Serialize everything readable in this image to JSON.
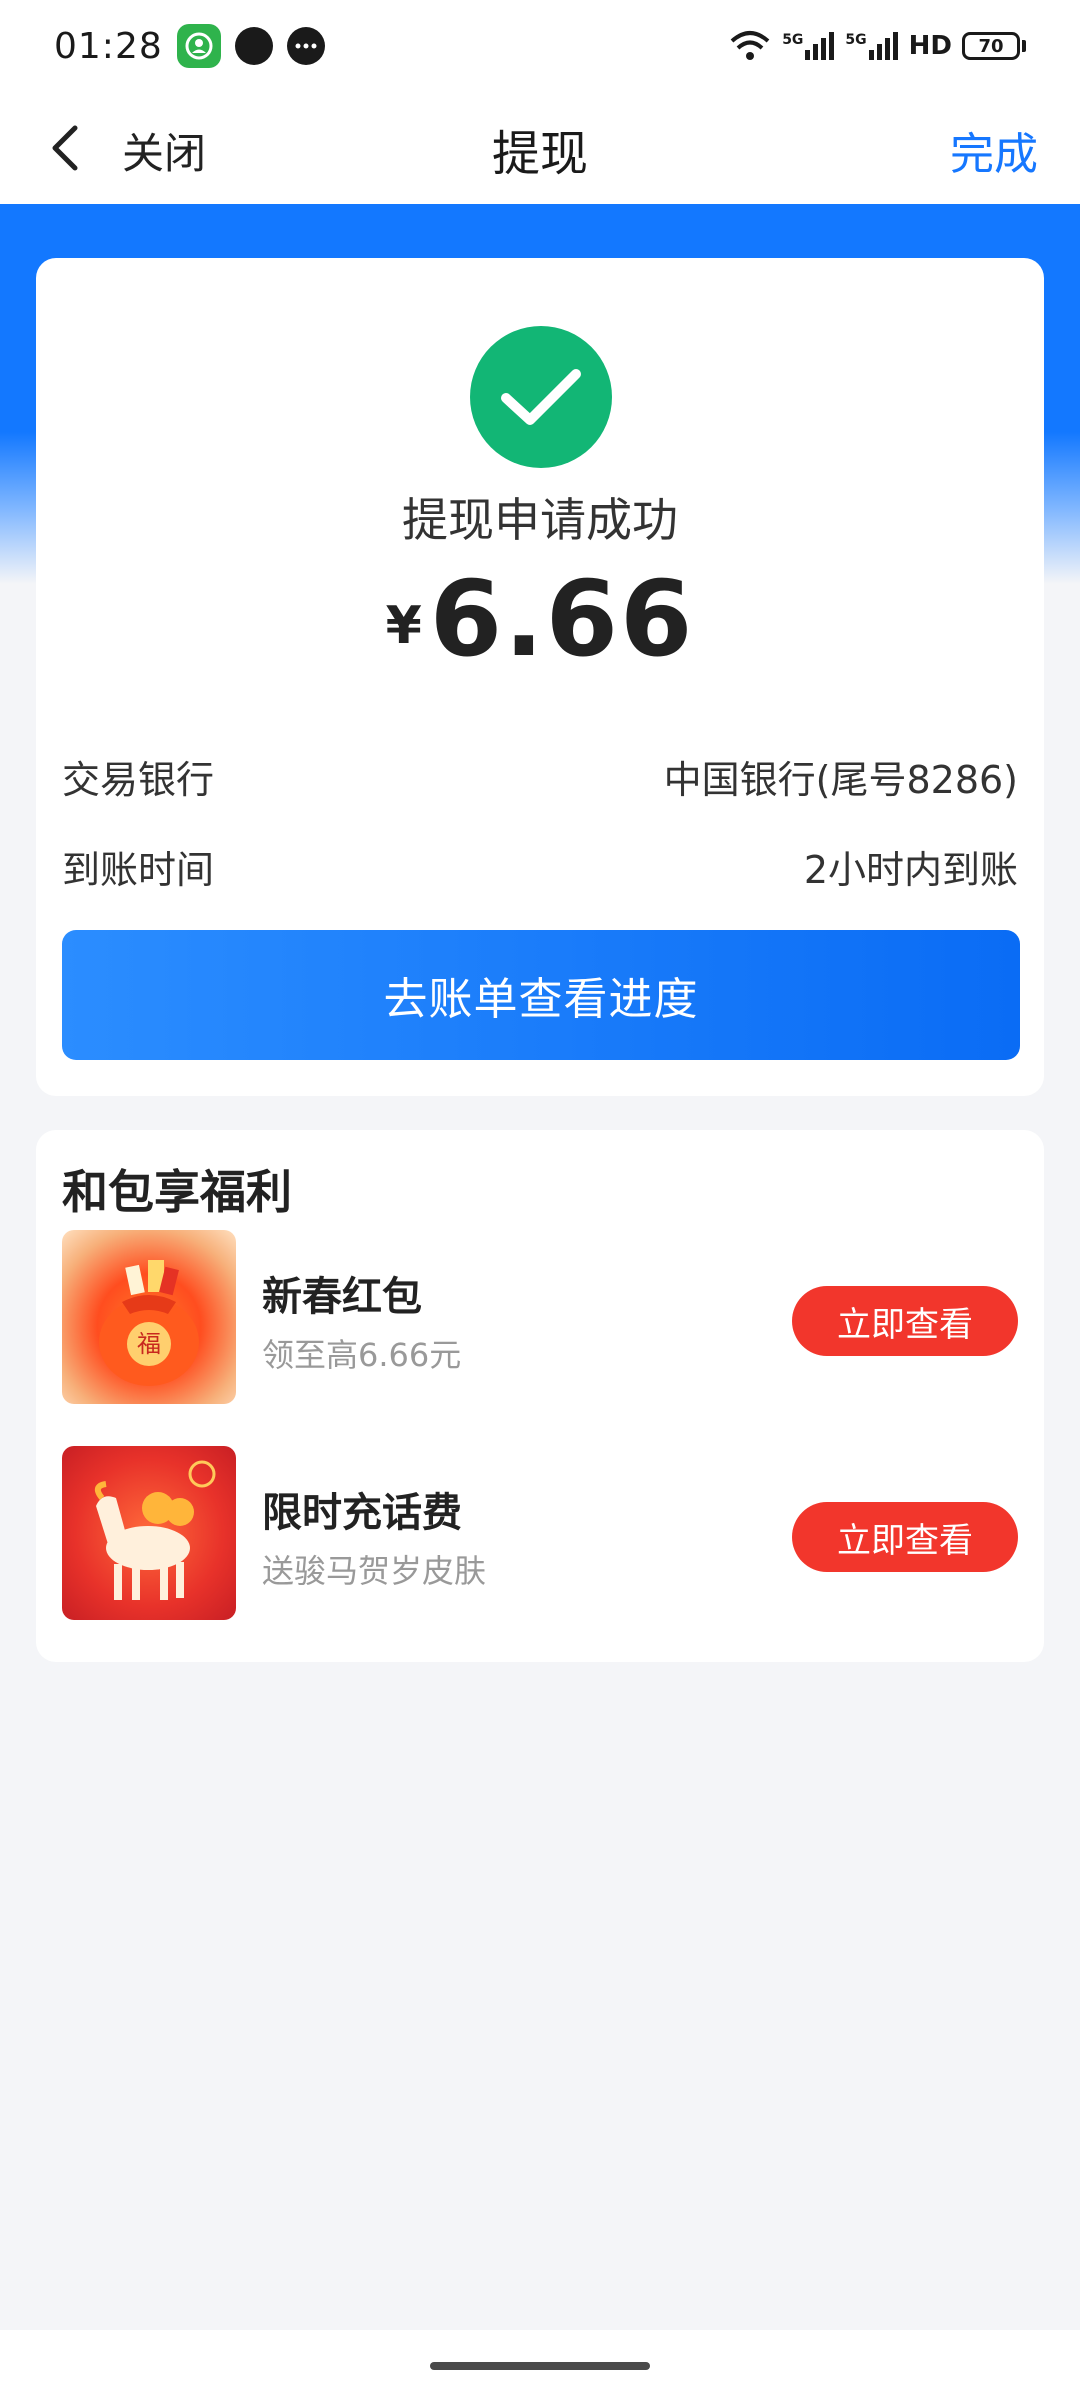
{
  "status_bar": {
    "time": "01:28",
    "network_label": "HD",
    "battery_level": "70",
    "signal_1_label": "5G",
    "signal_2_label": "5G"
  },
  "nav": {
    "close_label": "关闭",
    "title": "提现",
    "done_label": "完成"
  },
  "result": {
    "title": "提现申请成功",
    "currency": "¥",
    "amount": "6.66",
    "rows": [
      {
        "label": "交易银行",
        "value": "中国银行(尾号8286)"
      },
      {
        "label": "到账时间",
        "value": "2小时内到账"
      }
    ],
    "button_label": "去账单查看进度"
  },
  "benefits": {
    "title": "和包享福利",
    "items": [
      {
        "title": "新春红包",
        "subtitle": "领至高6.66元",
        "button_label": "立即查看"
      },
      {
        "title": "限时充话费",
        "subtitle": "送骏马贺岁皮肤",
        "button_label": "立即查看"
      }
    ]
  },
  "colors": {
    "brand_blue": "#1677ff",
    "success_green": "#12b675",
    "cta_red": "#f2362c"
  }
}
